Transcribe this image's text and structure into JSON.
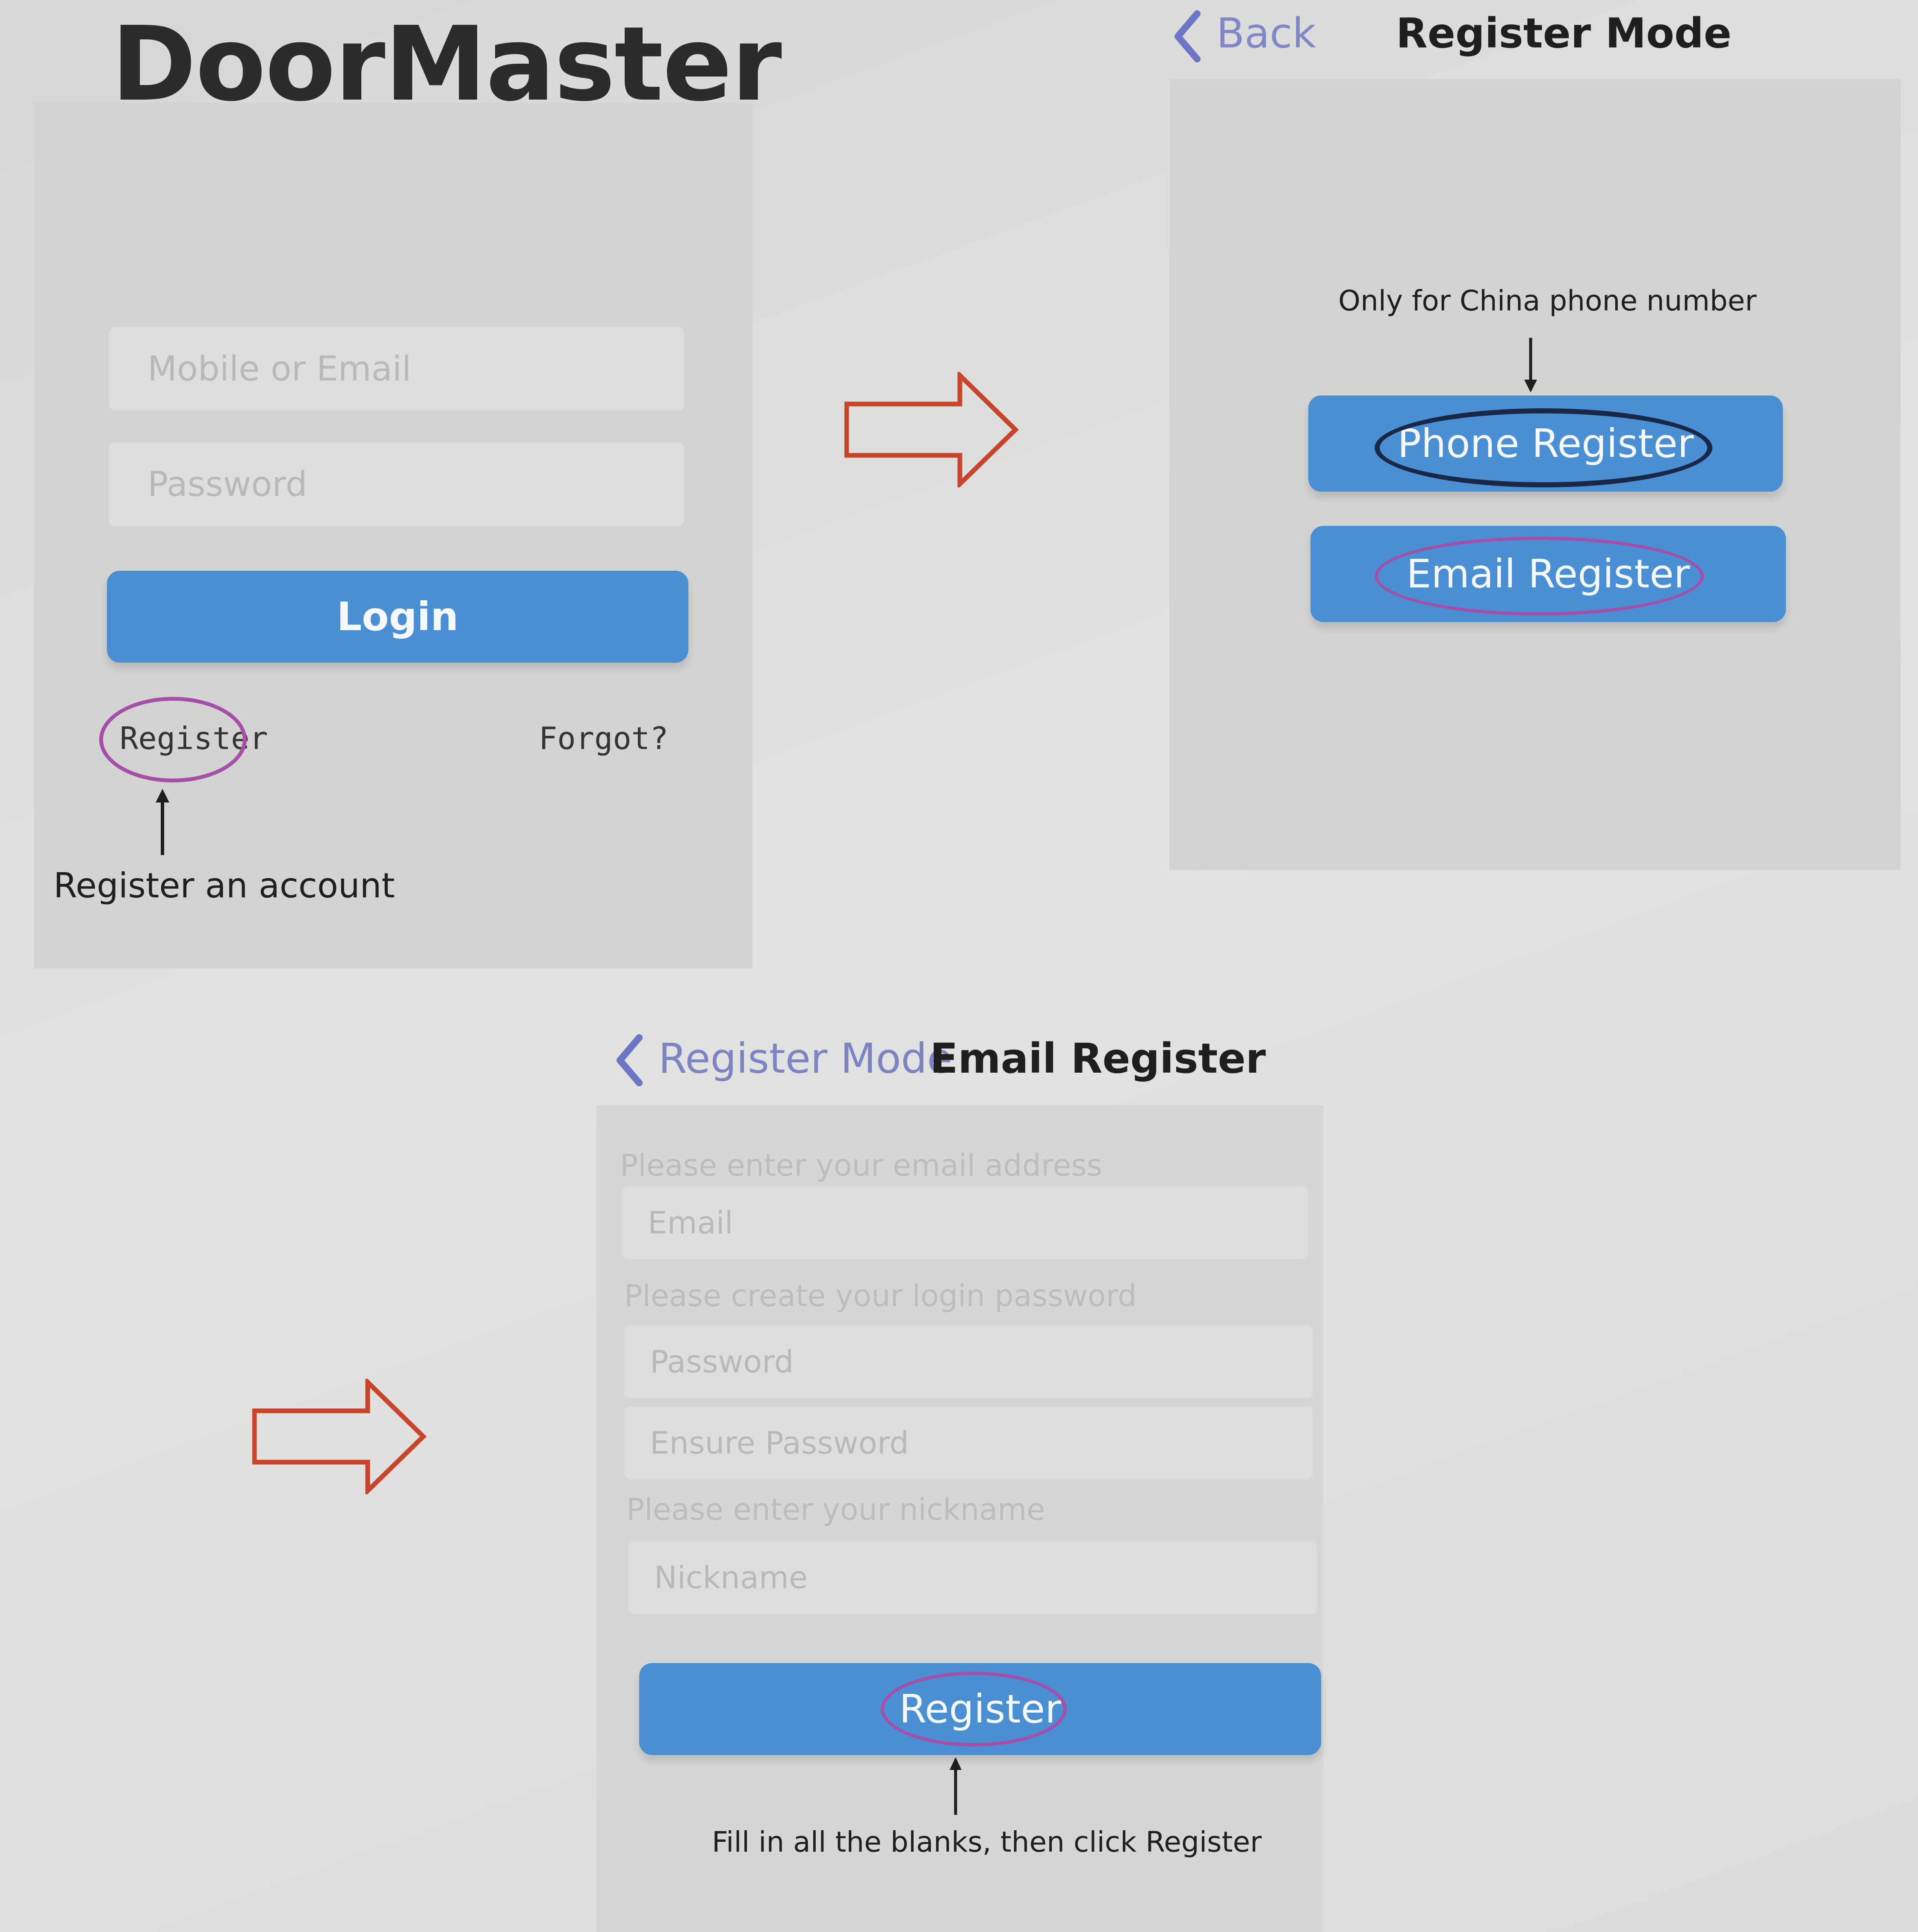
{
  "login_screen": {
    "logo": "DoorMaster",
    "account_placeholder": "Mobile or Email",
    "password_placeholder": "Password",
    "login_label": "Login",
    "register_label": "Register",
    "forgot_label": "Forgot?",
    "annotation": "Register an account"
  },
  "register_mode_screen": {
    "back_label": "Back",
    "title": "Register Mode",
    "annotation": "Only for China phone number",
    "phone_register_label": "Phone Register",
    "email_register_label": "Email Register"
  },
  "email_register_screen": {
    "back_label": "Register Mode",
    "title": "Email Register",
    "email_hint": "Please enter your email address",
    "email_placeholder": "Email",
    "password_hint": "Please create your login password",
    "password_placeholder": "Password",
    "confirm_placeholder": "Ensure Password",
    "nickname_hint": "Please enter your nickname",
    "nickname_placeholder": "Nickname",
    "register_label": "Register",
    "annotation": "Fill in all the blanks, then click Register"
  },
  "colors": {
    "accent_blue": "#4a8fd3",
    "arrow_red": "#c8452c",
    "oval_purple": "#a54fa8",
    "oval_navy": "#1a2848"
  }
}
